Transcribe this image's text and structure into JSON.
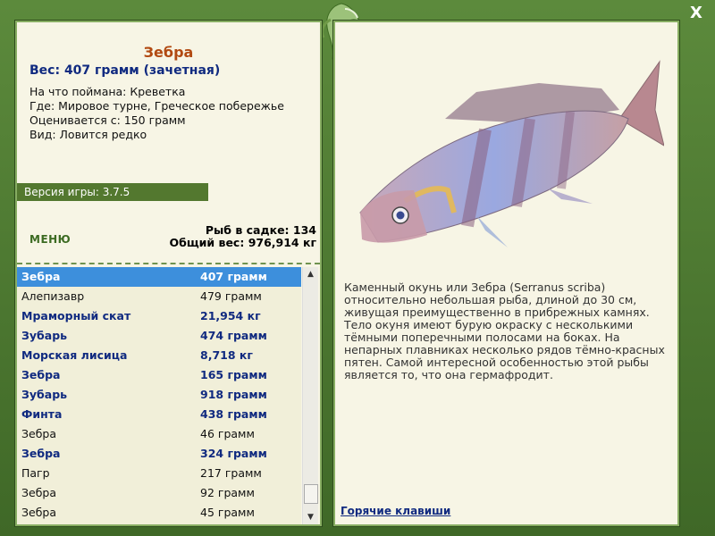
{
  "window": {
    "close_label": "X"
  },
  "fish": {
    "name": "Зебра",
    "weight": "Вес: 407 грамм (зачетная)",
    "caught_on": "На что поймана: Креветка",
    "location": "Где: Мировое турне, Греческое побережье",
    "rated_from": "Оценивается с: 150 грамм",
    "species": "Вид: Ловится редко"
  },
  "version": "Версия игры: 3.7.5",
  "menu_label": "МЕНЮ",
  "stats": {
    "count": "Рыб в садке: 134",
    "total_weight": "Общий вес: 976,914 кг"
  },
  "catch_list": [
    {
      "name": "Зебра",
      "weight": "407 грамм",
      "style": "selected"
    },
    {
      "name": "Алепизавр",
      "weight": "479 грамм",
      "style": "normal"
    },
    {
      "name": "Мраморный скат",
      "weight": "21,954 кг",
      "style": "bold"
    },
    {
      "name": "Зубарь",
      "weight": "474 грамм",
      "style": "bold"
    },
    {
      "name": "Морская лисица",
      "weight": "8,718 кг",
      "style": "bold"
    },
    {
      "name": "Зебра",
      "weight": "165 грамм",
      "style": "bold"
    },
    {
      "name": "Зубарь",
      "weight": "918 грамм",
      "style": "bold"
    },
    {
      "name": "Финта",
      "weight": "438 грамм",
      "style": "bold"
    },
    {
      "name": "Зебра",
      "weight": "46 грамм",
      "style": "normal"
    },
    {
      "name": "Зебра",
      "weight": "324 грамм",
      "style": "bold"
    },
    {
      "name": "Пагр",
      "weight": "217 грамм",
      "style": "normal"
    },
    {
      "name": "Зебра",
      "weight": "92 грамм",
      "style": "normal"
    },
    {
      "name": "Зебра",
      "weight": "45 грамм",
      "style": "normal"
    }
  ],
  "description": [
    "Каменный окунь или Зебра (Serranus scriba)",
    "относительно небольшая рыба, длиной до 30 см,",
    "живущая преимущественно в прибрежных камнях.",
    "Тело окуня имеют бурую окраску с несколькими",
    "тёмными поперечными полосами на боках. На",
    "непарных плавниках несколько рядов тёмно-красных",
    "пятен. Самой интересной особенностью этой рыбы",
    "является то, что она гермафродит."
  ],
  "hotkeys_label": "Горячие клавиши",
  "icons": {
    "emblem": "dolphin-emblem-icon",
    "close": "close-icon",
    "scroll_up": "scroll-up-arrow-icon",
    "scroll_down": "scroll-down-arrow-icon"
  }
}
